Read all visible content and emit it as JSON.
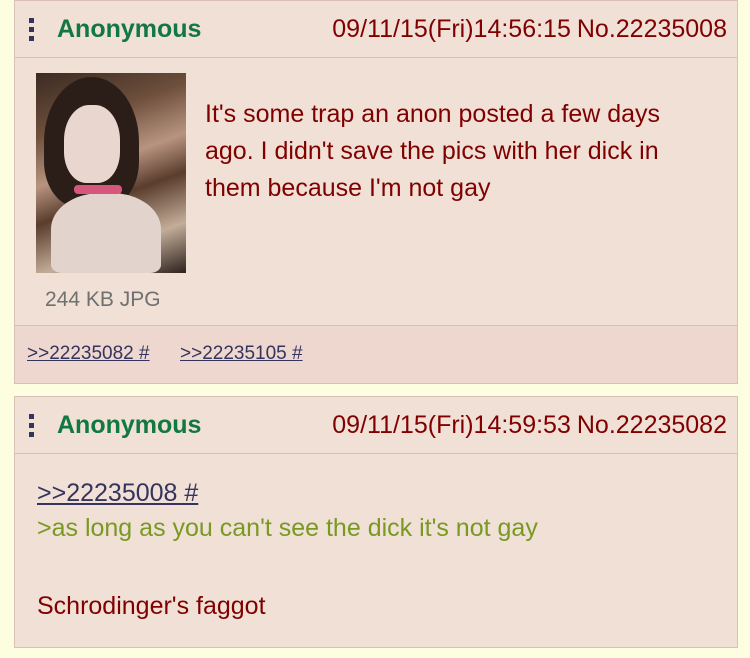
{
  "posts": [
    {
      "name": "Anonymous",
      "datetime": "09/11/15(Fri)14:56:15",
      "post_number": "No.22235008",
      "file_info": "244 KB JPG",
      "text": "It's some trap an anon posted a few days ago. I didn't save the pics with her dick in them because I'm not gay",
      "replies": [
        ">>22235082 #",
        ">>22235105 #"
      ]
    },
    {
      "name": "Anonymous",
      "datetime": "09/11/15(Fri)14:59:53",
      "post_number": "No.22235082",
      "quote_link": ">>22235008 #",
      "greentext": ">as long as you can't see the dick it's not gay",
      "text": "Schrodinger's faggot"
    }
  ],
  "colors": {
    "name": "#117743",
    "post_text": "#800000",
    "greentext": "#789922",
    "link": "#34345c",
    "post_bg": "#f0e0d6",
    "page_bg": "#fdfde0"
  }
}
